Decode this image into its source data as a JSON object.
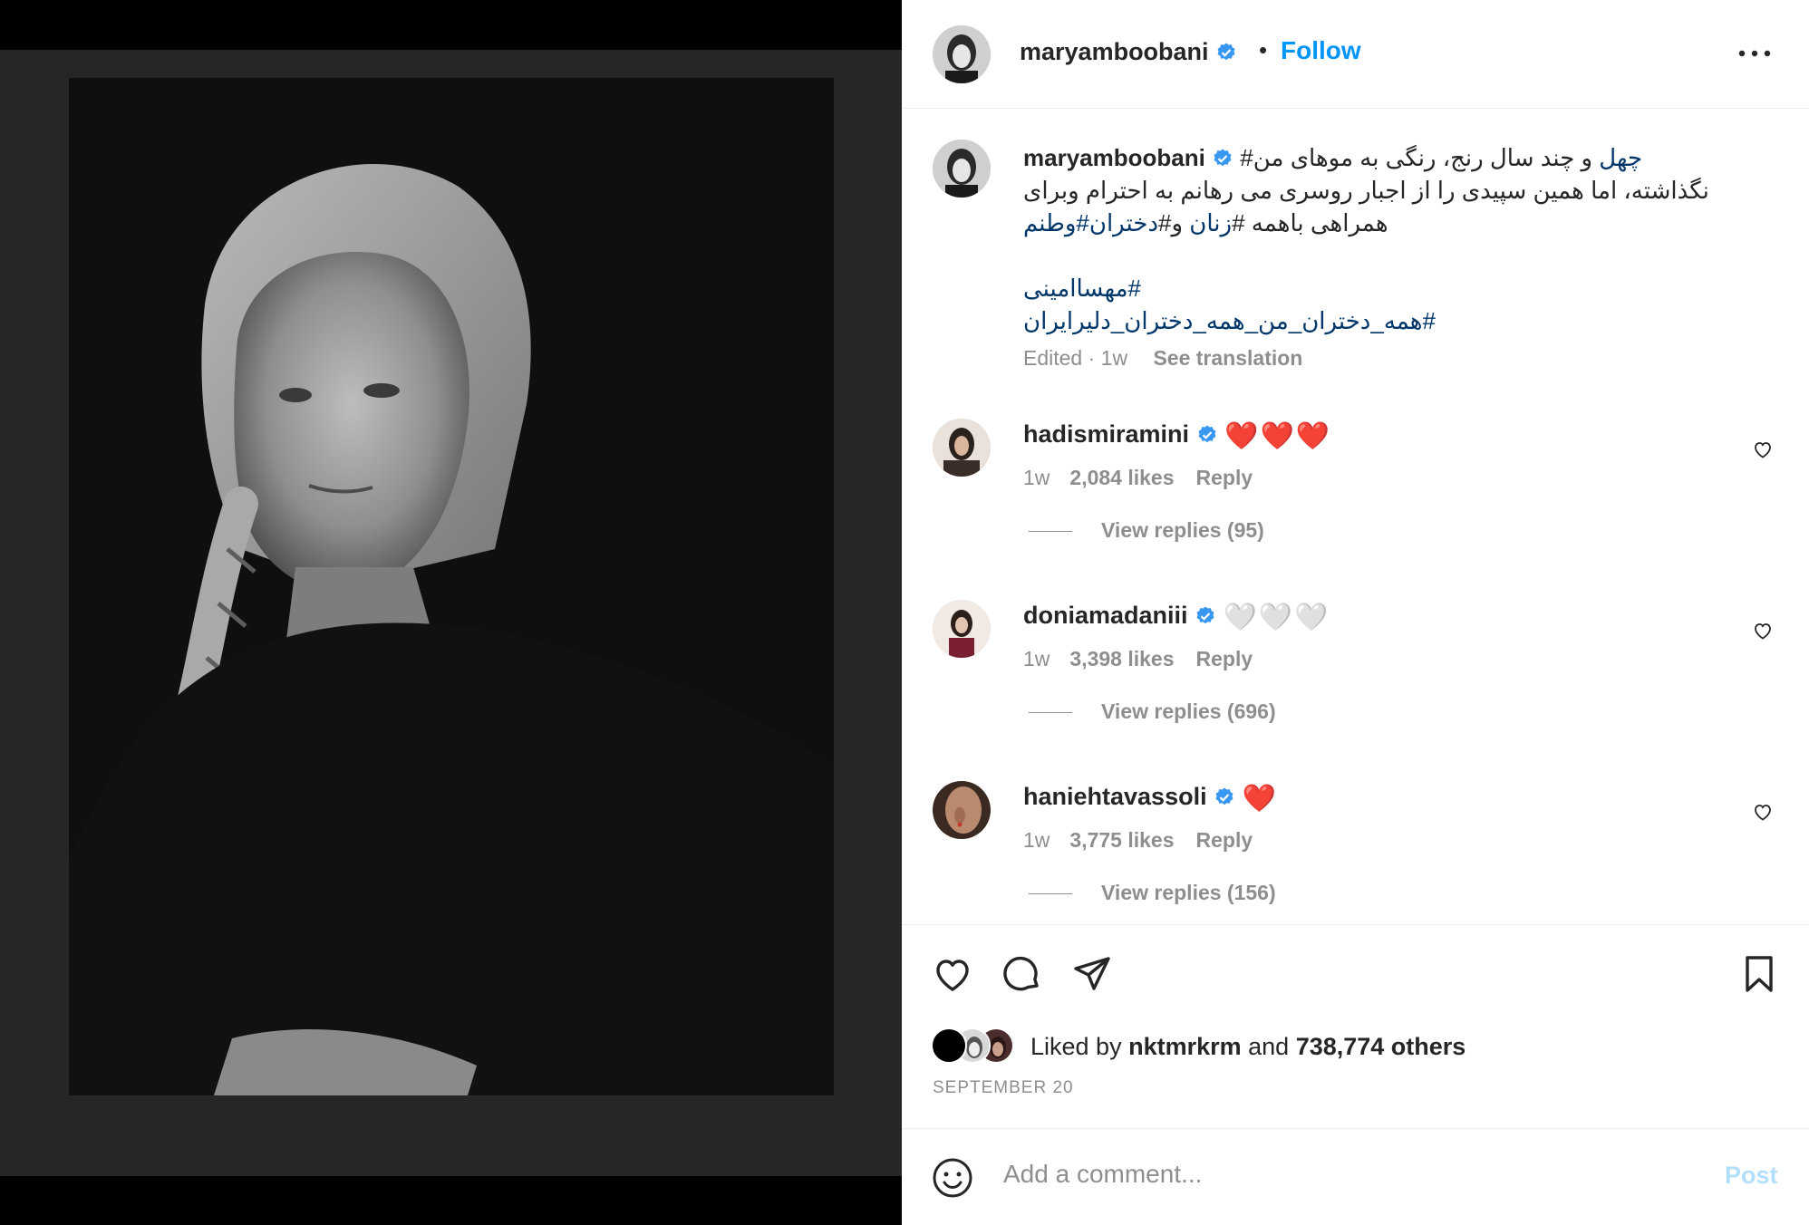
{
  "post": {
    "username": "maryamboobani",
    "follow_label": "Follow",
    "separator": "•"
  },
  "caption": {
    "username": "maryamboobani",
    "line1_tag": "چهل",
    "line1_text": " و چند سال رنج، رنگی به موهای من#",
    "line2_text": "نگذاشته، اما همین سپیدی را از اجبار روسری می رهانم به احترام وبرای",
    "line3_text": "همراهی باهمه #",
    "line3_tag1": "زنان",
    "line3_and": " و#",
    "line3_tag2": "دختران",
    "line3_tag3": "#وطنم",
    "hashtag1": "#مهساامینی",
    "hashtag2": "#همه_دختران_من_همه_دختران_دلیرایران",
    "edited": "Edited · 1w",
    "see_translation": "See translation"
  },
  "comments": [
    {
      "username": "hadismiramini",
      "emoji": "❤️❤️❤️",
      "time": "1w",
      "likes": "2,084 likes",
      "reply": "Reply",
      "view_replies": "View replies (95)"
    },
    {
      "username": "doniamadaniii",
      "emoji": "🤍🤍🤍",
      "time": "1w",
      "likes": "3,398 likes",
      "reply": "Reply",
      "view_replies": "View replies (696)"
    },
    {
      "username": "haniehtavassoli",
      "emoji": "❤️",
      "time": "1w",
      "likes": "3,775 likes",
      "reply": "Reply",
      "view_replies": "View replies (156)"
    }
  ],
  "likes": {
    "prefix": "Liked by ",
    "user": "nktmrkrm",
    "and": " and ",
    "others": "738,774 others"
  },
  "date": "SEPTEMBER 20",
  "composer": {
    "placeholder": "Add a comment...",
    "post_label": "Post"
  },
  "colors": {
    "accent": "#0095f6",
    "hashtag": "#00376b",
    "muted": "#8e8e8e",
    "verified": "#3897f0",
    "post_disabled": "#b2dffc"
  },
  "icons": [
    "verified-badge-icon",
    "more-options-icon",
    "heart-icon",
    "comment-icon",
    "share-icon",
    "bookmark-icon",
    "emoji-icon"
  ]
}
